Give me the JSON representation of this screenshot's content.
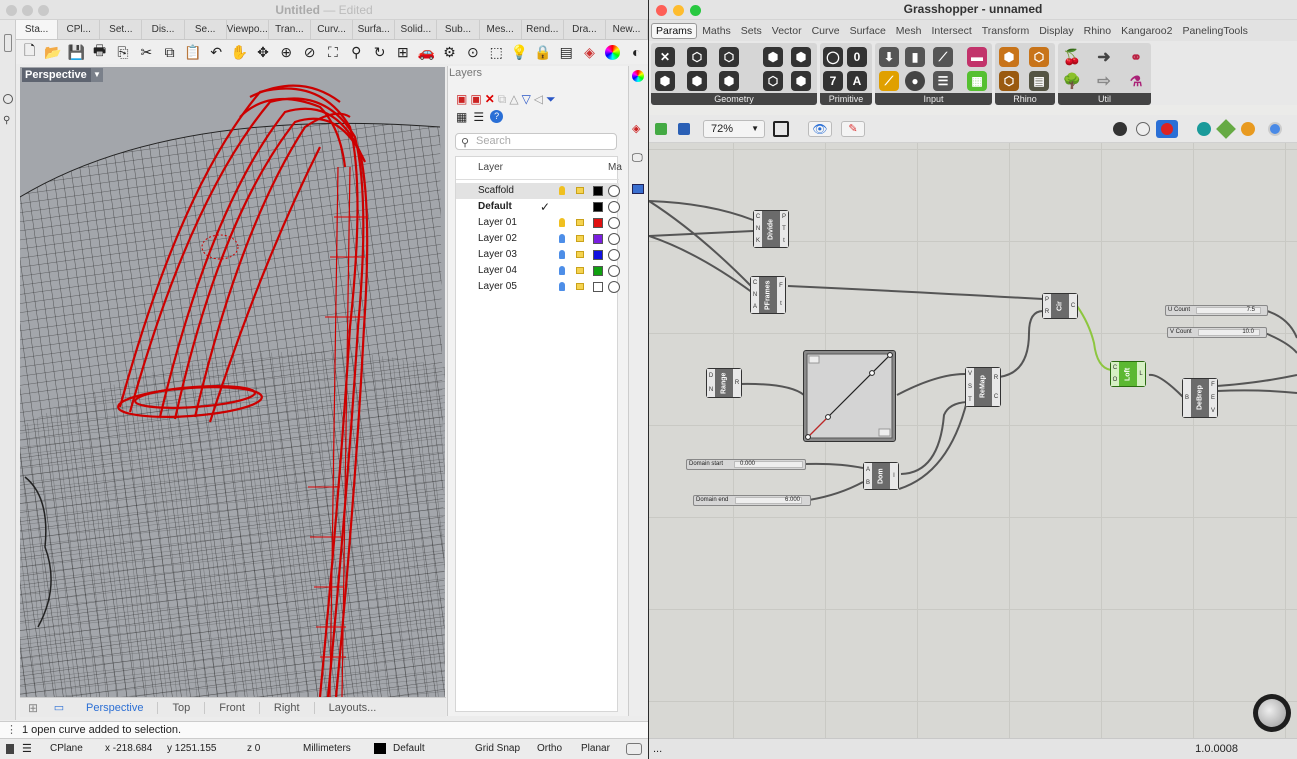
{
  "rhino": {
    "title": "Untitled",
    "title_suffix": "— Edited",
    "tabs": [
      "Sta...",
      "CPl...",
      "Set...",
      "Dis...",
      "Se...",
      "Viewpo...",
      "Tran...",
      "Curv...",
      "Surfa...",
      "Solid...",
      "Sub...",
      "Mes...",
      "Rend...",
      "Dra...",
      "New..."
    ],
    "viewport_label": "Perspective",
    "layers_title": "Layers",
    "layer_search_placeholder": "Search",
    "layer_header": {
      "name": "Layer",
      "material": "Ma"
    },
    "layers": [
      {
        "name": "Scaffold",
        "color": "#000000",
        "bulb": "#f0c020",
        "selected": true
      },
      {
        "name": "Default",
        "color": "#000000",
        "current": true,
        "check": "✓"
      },
      {
        "name": "Layer 01",
        "color": "#e01010",
        "bulb": "#f0c020"
      },
      {
        "name": "Layer 02",
        "color": "#7a1ee0",
        "bulb": "#4d8ee8"
      },
      {
        "name": "Layer 03",
        "color": "#1010e0",
        "bulb": "#4d8ee8"
      },
      {
        "name": "Layer 04",
        "color": "#10a010",
        "bulb": "#4d8ee8"
      },
      {
        "name": "Layer 05",
        "color": "#ffffff",
        "bulb": "#4d8ee8"
      }
    ],
    "view_tabs": [
      "Perspective",
      "Top",
      "Front",
      "Right",
      "Layouts..."
    ],
    "command_output": "1 open curve added to selection.",
    "status": {
      "cplane": "CPlane",
      "x": "x -218.684",
      "y": "y 1251.155",
      "z": "z 0",
      "units": "Millimeters",
      "layer": "Default",
      "grid_snap": "Grid Snap",
      "ortho": "Ortho",
      "planar": "Planar"
    }
  },
  "grasshopper": {
    "title": "Grasshopper - unnamed",
    "menu": [
      "Params",
      "Maths",
      "Sets",
      "Vector",
      "Curve",
      "Surface",
      "Mesh",
      "Intersect",
      "Transform",
      "Display",
      "Rhino",
      "Kangaroo2",
      "PanelingTools"
    ],
    "ribbon_groups": [
      "Geometry",
      "Primitive",
      "Input",
      "Rhino",
      "Util"
    ],
    "zoom": "72%",
    "components": {
      "divide": "Divide",
      "pframes": "PFrames",
      "circle": "Cir",
      "loft": "Loft",
      "range": "Range",
      "remap": "ReMap",
      "dom": "Dom",
      "debrep": "DeBrep"
    },
    "sliders": {
      "u_count": {
        "label": "U Count",
        "value": "7.5"
      },
      "v_count": {
        "label": "V Count",
        "value": "10.0"
      },
      "domain_start": {
        "label": "Domain start",
        "value": "0.000"
      },
      "domain_end": {
        "label": "Domain end",
        "value": "6.000"
      }
    },
    "status_left": "...",
    "version": "1.0.0008"
  }
}
